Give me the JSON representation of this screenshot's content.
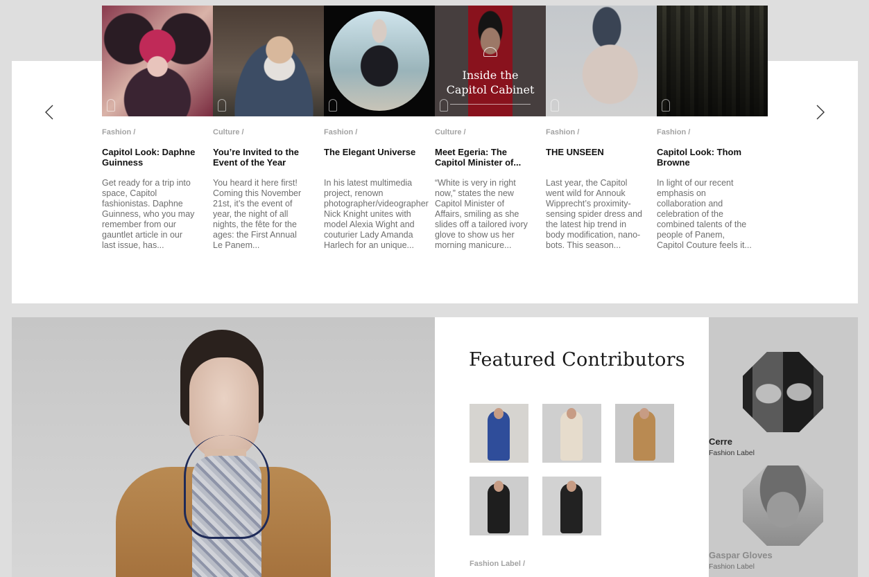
{
  "carousel": {
    "prev_label": "‹",
    "next_label": "›",
    "articles": [
      {
        "category": "Fashion /",
        "title": "Capitol Look: Daphne Guinness",
        "excerpt": "Get ready for a trip into\nspace, Capitol\nfashionistas. Daphne\nGuinness, who you may\nremember from our\ngauntlet article in our\nlast issue, has..."
      },
      {
        "category": "Culture /",
        "title": "You’re Invited to the Event of the Year",
        "excerpt": "You heard it here first!\nComing this November\n21st, it’s the event of\nyear, the night of all\nnights, the fête for the\nages: the First Annual\nLe Panem..."
      },
      {
        "category": "Fashion /",
        "title": "The Elegant Universe",
        "excerpt": "In his latest multimedia\nproject, renown\nphotographer/videographer\nNick Knight unites with\nmodel Alexia Wight and\ncouturier Lady Amanda\nHarlech for an unique..."
      },
      {
        "category": "Culture /",
        "title": "Meet Egeria: The Capitol Minister of...",
        "excerpt": "“White is very in right\nnow,” states the new\nCapitol Minister of\nAffairs, smiling as she\nslides off a tailored ivory\nglove to show us her\nmorning manicure...",
        "image_overlay_title": "Inside the\nCapitol Cabinet"
      },
      {
        "category": "Fashion /",
        "title": "THE UNSEEN",
        "excerpt": "Last year, the Capitol\nwent wild for Annouk\nWipprecht’s proximity-\nsensing spider dress and\nthe latest hip trend in\nbody modification, nano-\nbots. This season..."
      },
      {
        "category": "Fashion /",
        "title": "Capitol Look: Thom Browne",
        "excerpt": "In light of our recent\nemphasis on\ncollaboration and\ncelebration of the\ncombined talents of the\npeople of Panem,\nCapitol Couture feels it..."
      }
    ]
  },
  "featured": {
    "title": "Featured Contributors",
    "category": "Fashion Label /",
    "gallery": [
      {
        "icon": "blue-coat-photo",
        "accent": "#2f4d9a"
      },
      {
        "icon": "cream-hood-photo",
        "accent": "#e6dccc"
      },
      {
        "icon": "tan-jacket-photo",
        "accent": "#b98a52"
      },
      {
        "icon": "black-coat-photo",
        "accent": "#1e1e1e"
      },
      {
        "icon": "black-dress-photo",
        "accent": "#222222"
      }
    ],
    "contributors": [
      {
        "name": "Cerre",
        "role": "Fashion Label"
      },
      {
        "name": "Gaspar Gloves",
        "role": "Fashion Label"
      }
    ]
  },
  "colors": {
    "background": "#dedede",
    "category_gray": "#a3a3a3",
    "excerpt_gray": "#6e6e6e"
  }
}
